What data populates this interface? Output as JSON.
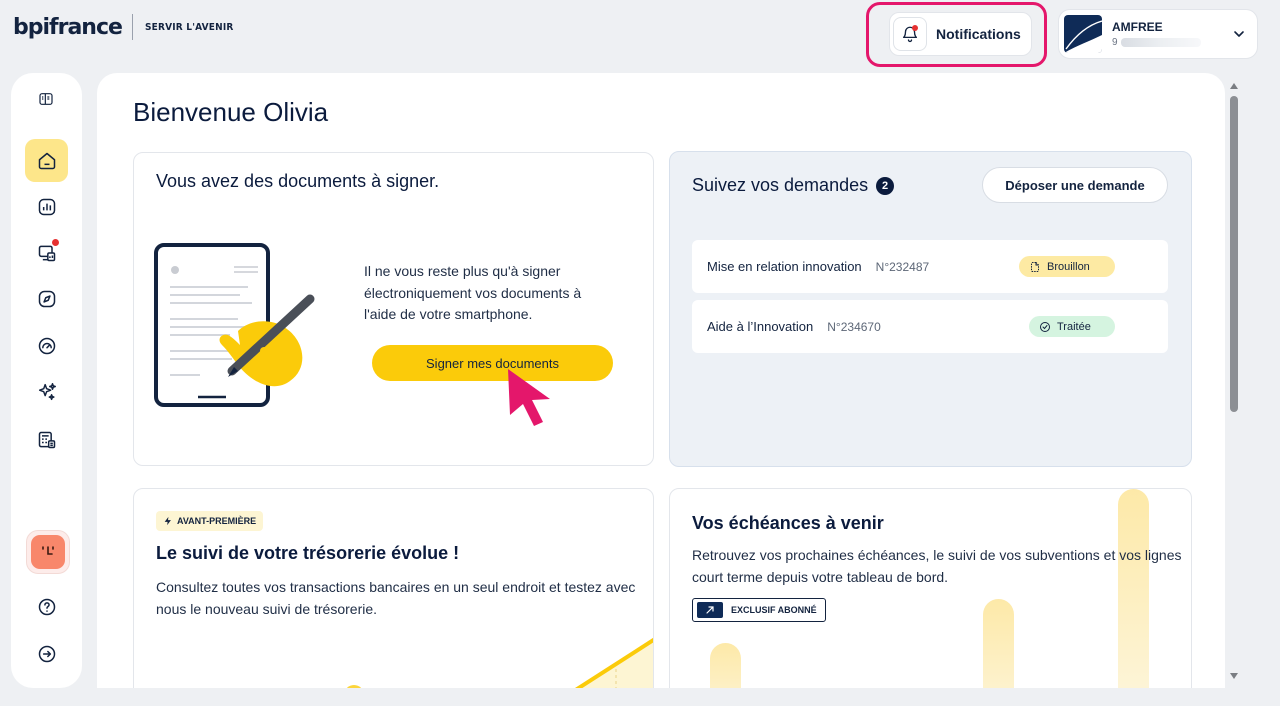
{
  "header": {
    "logo_text": "bpifrance",
    "tagline": "SERVIR L'AVENIR",
    "notifications_label": "Notifications",
    "account_name": "AMFREE",
    "account_id_prefix": "9"
  },
  "sidebar": {
    "items": [
      {
        "icon": "panel-toggle-icon"
      },
      {
        "icon": "home-icon",
        "active": true
      },
      {
        "icon": "chart-icon"
      },
      {
        "icon": "monitor-chart-icon",
        "badge": true
      },
      {
        "icon": "compass-icon"
      },
      {
        "icon": "dashboard-gauge-icon"
      },
      {
        "icon": "sparkles-icon"
      },
      {
        "icon": "calculator-icon"
      }
    ],
    "footer": [
      {
        "icon": "help-icon"
      },
      {
        "icon": "logout-icon"
      }
    ]
  },
  "main": {
    "title": "Bienvenue Olivia",
    "sign_card": {
      "title": "Vous avez des documents à signer.",
      "text": "Il ne vous reste plus qu'à signer électroniquement vos documents à l'aide de votre smartphone.",
      "button": "Signer mes documents"
    },
    "requests_card": {
      "title": "Suivez vos demandes",
      "count": "2",
      "button": "Déposer une demande",
      "rows": [
        {
          "name": "Mise en relation innovation",
          "number": "N°232487",
          "status": "Brouillon",
          "status_color": "#fdeaa3"
        },
        {
          "name": "Aide à l’Innovation",
          "number": "N°234670",
          "status": "Traitée",
          "status_color": "#d5f4e0"
        }
      ]
    },
    "treasury_card": {
      "tag": "AVANT-PREMIÈRE",
      "title": "Le suivi de votre trésorerie évolue !",
      "text": "Consultez toutes vos transactions bancaires en un seul endroit et testez avec nous le nouveau suivi de trésorerie."
    },
    "deadlines_card": {
      "title": "Vos échéances à venir",
      "text": "Retrouvez vos prochaines échéances, le suivi de vos subventions et vos lignes court terme depuis votre tableau de bord.",
      "tag": "EXCLUSIF ABONNÉ"
    }
  },
  "colors": {
    "accent_yellow": "#fbcb0a",
    "highlight_pink": "#e4176b",
    "navy": "#0b1b3d"
  }
}
